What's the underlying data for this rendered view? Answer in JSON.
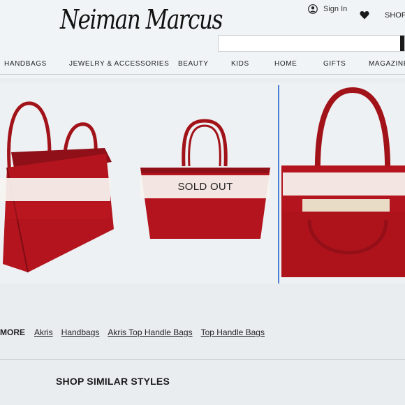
{
  "header": {
    "logo": "Neiman Marcus",
    "signin_label": "Sign In",
    "shop_label": "SHOPP",
    "search_placeholder": ""
  },
  "nav": {
    "items": [
      "HANDBAGS",
      "JEWELRY & ACCESSORIES",
      "BEAUTY",
      "KIDS",
      "HOME",
      "GIFTS",
      "MAGAZINE"
    ]
  },
  "product": {
    "sold_out_label": "SOLD OUT",
    "bag_color": "#b3141d",
    "handle_color": "#a11219"
  },
  "breadcrumb": {
    "more_label": "MORE",
    "links": [
      "Akris",
      "Handbags",
      "Akris Top Handle Bags",
      "Top Handle Bags"
    ]
  },
  "similar": {
    "title": "SHOP SIMILAR STYLES"
  }
}
